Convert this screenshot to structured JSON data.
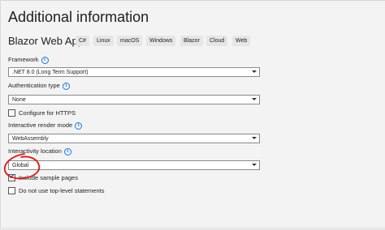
{
  "header": {
    "title": "Additional information",
    "template": "Blazor Web App",
    "tags": [
      "C#",
      "Linux",
      "macOS",
      "Windows",
      "Blazor",
      "Cloud",
      "Web"
    ]
  },
  "form": {
    "framework": {
      "label": "Framework",
      "value": ".NET 8.0 (Long Term Support)"
    },
    "auth": {
      "label": "Authentication type",
      "value": "None"
    },
    "https": {
      "label": "Configure for HTTPS",
      "checked": false
    },
    "render_mode": {
      "label": "Interactive render mode",
      "value": "WebAssembly"
    },
    "location": {
      "label": "Interactivity location",
      "value": "Global"
    },
    "sample_pages": {
      "label": "Include sample pages",
      "checked": true
    },
    "top_level": {
      "label": "Do not use top-level statements",
      "checked": false
    }
  },
  "icons": {
    "info": "info-icon",
    "dropdown": "chevron-down-icon",
    "check": "checkmark-icon"
  },
  "colors": {
    "info_blue": "#1a73e8",
    "annotation_red": "#d71a1a",
    "background": "#f3f3f3"
  }
}
